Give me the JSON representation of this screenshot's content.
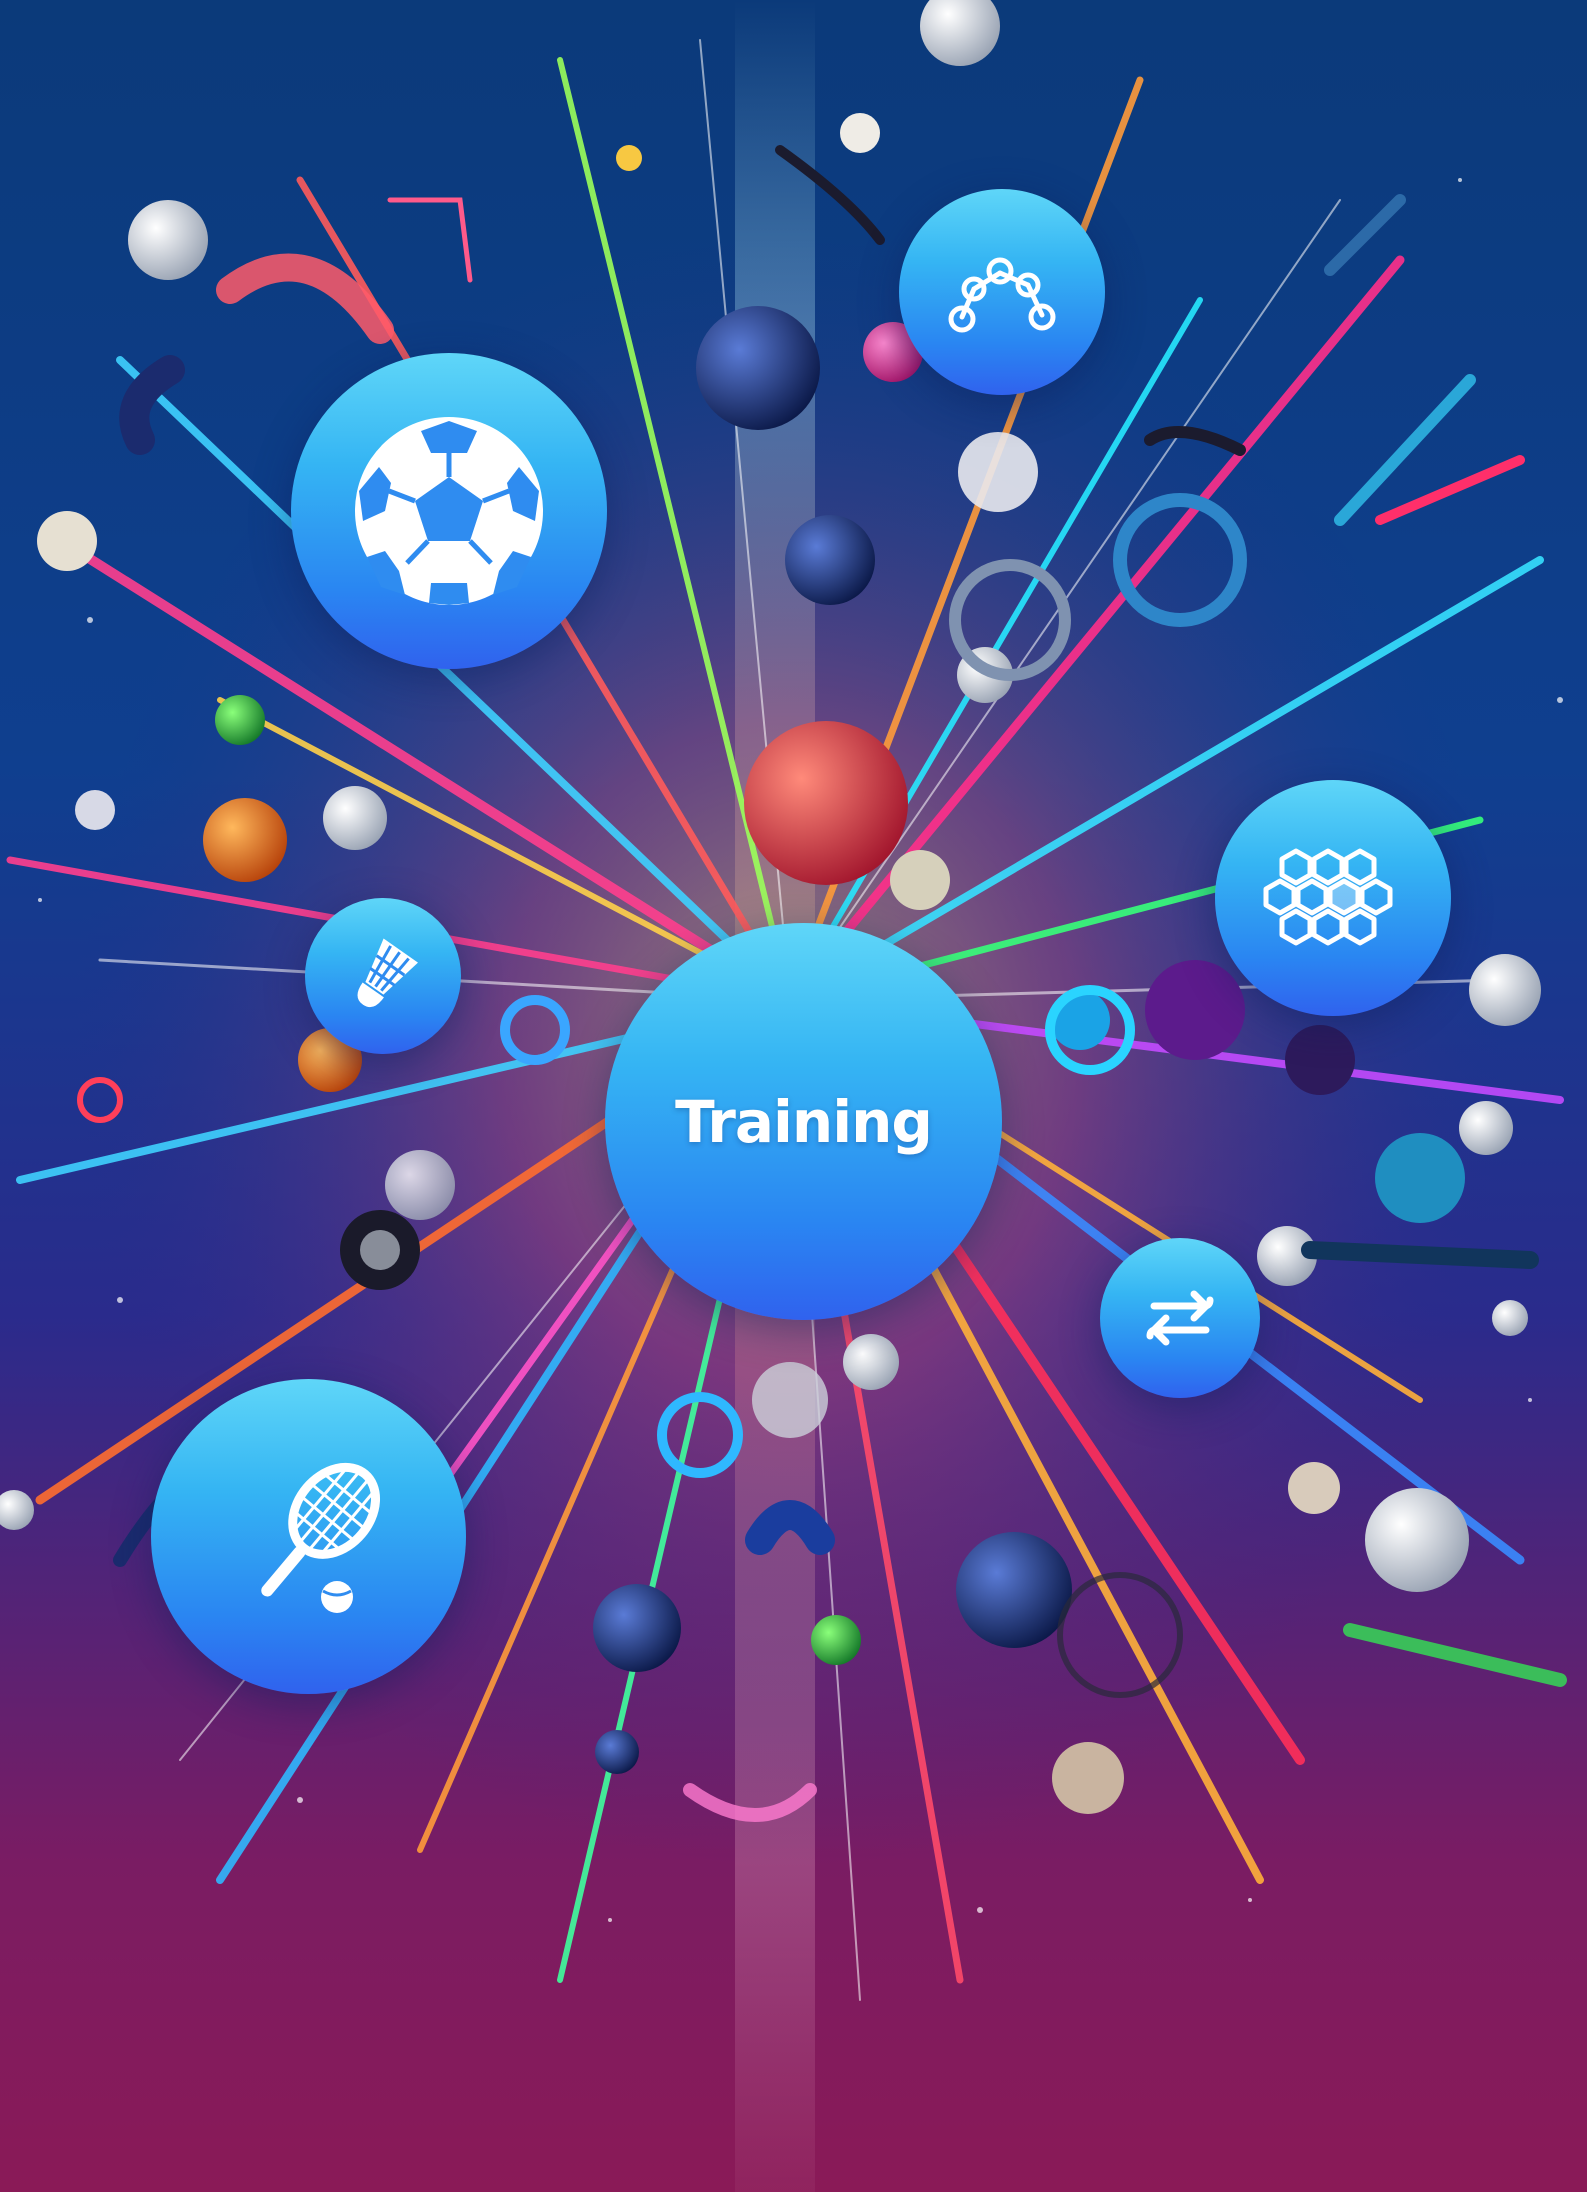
{
  "center_bubble": {
    "label": "Training"
  },
  "icons": {
    "soccer": "soccer-ball-icon",
    "network": "network-nodes-icon",
    "hexagons": "hexagon-grid-icon",
    "badminton": "shuttlecock-icon",
    "swap": "swap-arrows-icon",
    "tennis": "tennis-racket-icon"
  },
  "colors": {
    "bubble_top": "#5fd6f8",
    "bubble_bottom": "#3062ee",
    "icon": "#ffffff",
    "background_top": "#0b3a7a",
    "background_bottom": "#8a1a57"
  }
}
